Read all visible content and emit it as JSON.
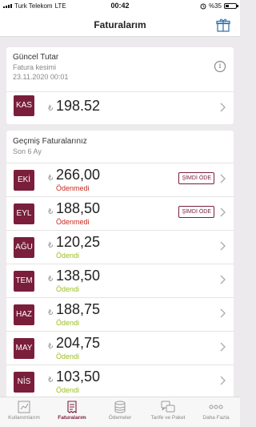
{
  "status_bar": {
    "carrier": "Turk Telekom",
    "network": "LTE",
    "time": "00:42",
    "battery": "%35",
    "battery_level": 0.35
  },
  "header": {
    "title": "Faturalarım",
    "gift_icon": "gift-icon"
  },
  "current": {
    "heading": "Güncel Tutar",
    "subtitle": "Fatura kesimi",
    "date": "23.11.2020 00:01",
    "month": "KAS",
    "currency": "₺",
    "amount": "198.52"
  },
  "history": {
    "heading": "Geçmiş Faturalarınız",
    "subtitle": "Son 6 Ay",
    "pay_label": "ŞİMDİ ÖDE",
    "rows": [
      {
        "month": "EKİ",
        "currency": "₺",
        "amount": "266,00",
        "status": "Ödenmedi"
      },
      {
        "month": "EYL",
        "currency": "₺",
        "amount": "188,50",
        "status": "Ödenmedi"
      },
      {
        "month": "AĞU",
        "currency": "₺",
        "amount": "120,25",
        "status": "Ödendi"
      },
      {
        "month": "TEM",
        "currency": "₺",
        "amount": "138,50",
        "status": "Ödendi"
      },
      {
        "month": "HAZ",
        "currency": "₺",
        "amount": "188,75",
        "status": "Ödendi"
      },
      {
        "month": "MAY",
        "currency": "₺",
        "amount": "204,75",
        "status": "Ödendi"
      },
      {
        "month": "NİS",
        "currency": "₺",
        "amount": "103,50",
        "status": "Ödendi"
      }
    ]
  },
  "tabs": [
    {
      "label": "Kullanımlarım",
      "icon": "chart-icon"
    },
    {
      "label": "Faturalarım",
      "icon": "receipt-icon",
      "active": true
    },
    {
      "label": "Ödemeler",
      "icon": "coins-icon"
    },
    {
      "label": "Tarife ve Paket",
      "icon": "chat-icon"
    },
    {
      "label": "Daha Fazla",
      "icon": "more-icon"
    }
  ],
  "colors": {
    "accent": "#7a1e3c",
    "unpaid": "#c8281e",
    "paid": "#9cbf22"
  }
}
